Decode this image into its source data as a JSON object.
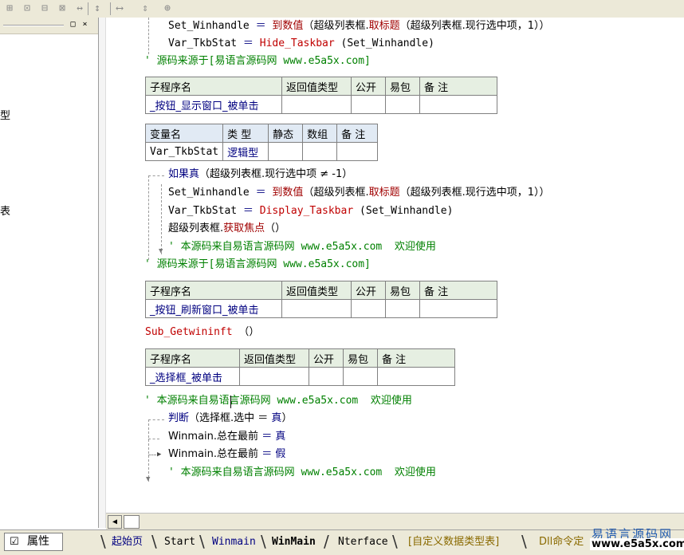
{
  "toolbar": {
    "icons": [
      "grid-icon",
      "window-icon",
      "table-icon",
      "split-icon",
      "width-icon",
      "height-icon",
      "hresize-icon",
      "vresize-icon",
      "fit-icon"
    ]
  },
  "left_panel": {
    "controls": [
      "□",
      "×"
    ],
    "visible_chars": [
      "型",
      "表"
    ]
  },
  "code": {
    "block1": {
      "line1": {
        "var": "Set_Winhandle",
        "op": "＝",
        "fn": "到数值",
        "rest": "（超级列表框.",
        "fn2": "取标题",
        "rest2": "（超级列表框.现行选中项，1））"
      },
      "line2": {
        "var": "Var_TkbStat",
        "op": "＝",
        "fn": "Hide_Taskbar",
        "rest": "(Set_Winhandle)"
      },
      "comment": "' 源码来源于[易语言源码网 www.e5a5x.com]"
    },
    "sub1": {
      "headers": [
        "子程序名",
        "返回值类型",
        "公开",
        "易包",
        "备 注"
      ],
      "name": "_按钮_显示窗口_被单击"
    },
    "vars1": {
      "headers": [
        "变量名",
        "类 型",
        "静态",
        "数组",
        "备 注"
      ],
      "name": "Var_TkbStat",
      "type": "逻辑型"
    },
    "block2": {
      "if_line": {
        "kw": "如果真",
        "rest": "（超级列表框.现行选中项 ≠ -1）"
      },
      "line1": {
        "var": "Set_Winhandle",
        "op": "＝",
        "fn": "到数值",
        "rest": "（超级列表框.",
        "fn2": "取标题",
        "rest2": "（超级列表框.现行选中项，1））"
      },
      "line2": {
        "var": "Var_TkbStat",
        "op": "＝",
        "fn": "Display_Taskbar",
        "rest": "(Set_Winhandle)"
      },
      "line3": {
        "obj": "超级列表框.",
        "fn": "获取焦点",
        "rest": "（）"
      },
      "inner_comment": "' 本源码来自易语言源码网 www.e5a5x.com  欢迎使用",
      "comment": "' 源码来源于[易语言源码网 www.e5a5x.com]"
    },
    "sub2": {
      "headers": [
        "子程序名",
        "返回值类型",
        "公开",
        "易包",
        "备 注"
      ],
      "name": "_按钮_刷新窗口_被单击"
    },
    "call_line": {
      "fn": "Sub_Getwininft",
      "rest": "（）"
    },
    "sub3": {
      "headers": [
        "子程序名",
        "返回值类型",
        "公开",
        "易包",
        "备 注"
      ],
      "name": "_选择框_被单击"
    },
    "block3": {
      "comment": "' 本源码来自易语言源码网 www.e5a5x.com  欢迎使用",
      "if_line": {
        "kw": "判断",
        "rest": "（选择框.选中 ＝ ",
        "val": "真",
        "end": "）"
      },
      "line1": {
        "obj": "Winmain.总在最前",
        "op": "＝",
        "val": "真"
      },
      "line2": {
        "obj": "Winmain.总在最前",
        "op": "＝",
        "val": "假"
      },
      "inner_comment": "' 本源码来自易语言源码网 www.e5a5x.com  欢迎使用"
    },
    "gutter_arrow": "↓"
  },
  "bottom": {
    "property_tab": "属性",
    "tabs": [
      "起始页",
      "Start",
      "Winmain",
      "WinMain",
      "Nterface",
      "[自定义数据类型表]",
      "Dll命令定"
    ],
    "watermark_cn": "易语言源码网",
    "watermark_url": "www.e5a5x.com"
  },
  "colors": {
    "keyword": "#000080",
    "function": "#c00000",
    "comment": "#008000",
    "table_header_green": "#e6efe2",
    "table_header_blue": "#e1eaf4"
  }
}
